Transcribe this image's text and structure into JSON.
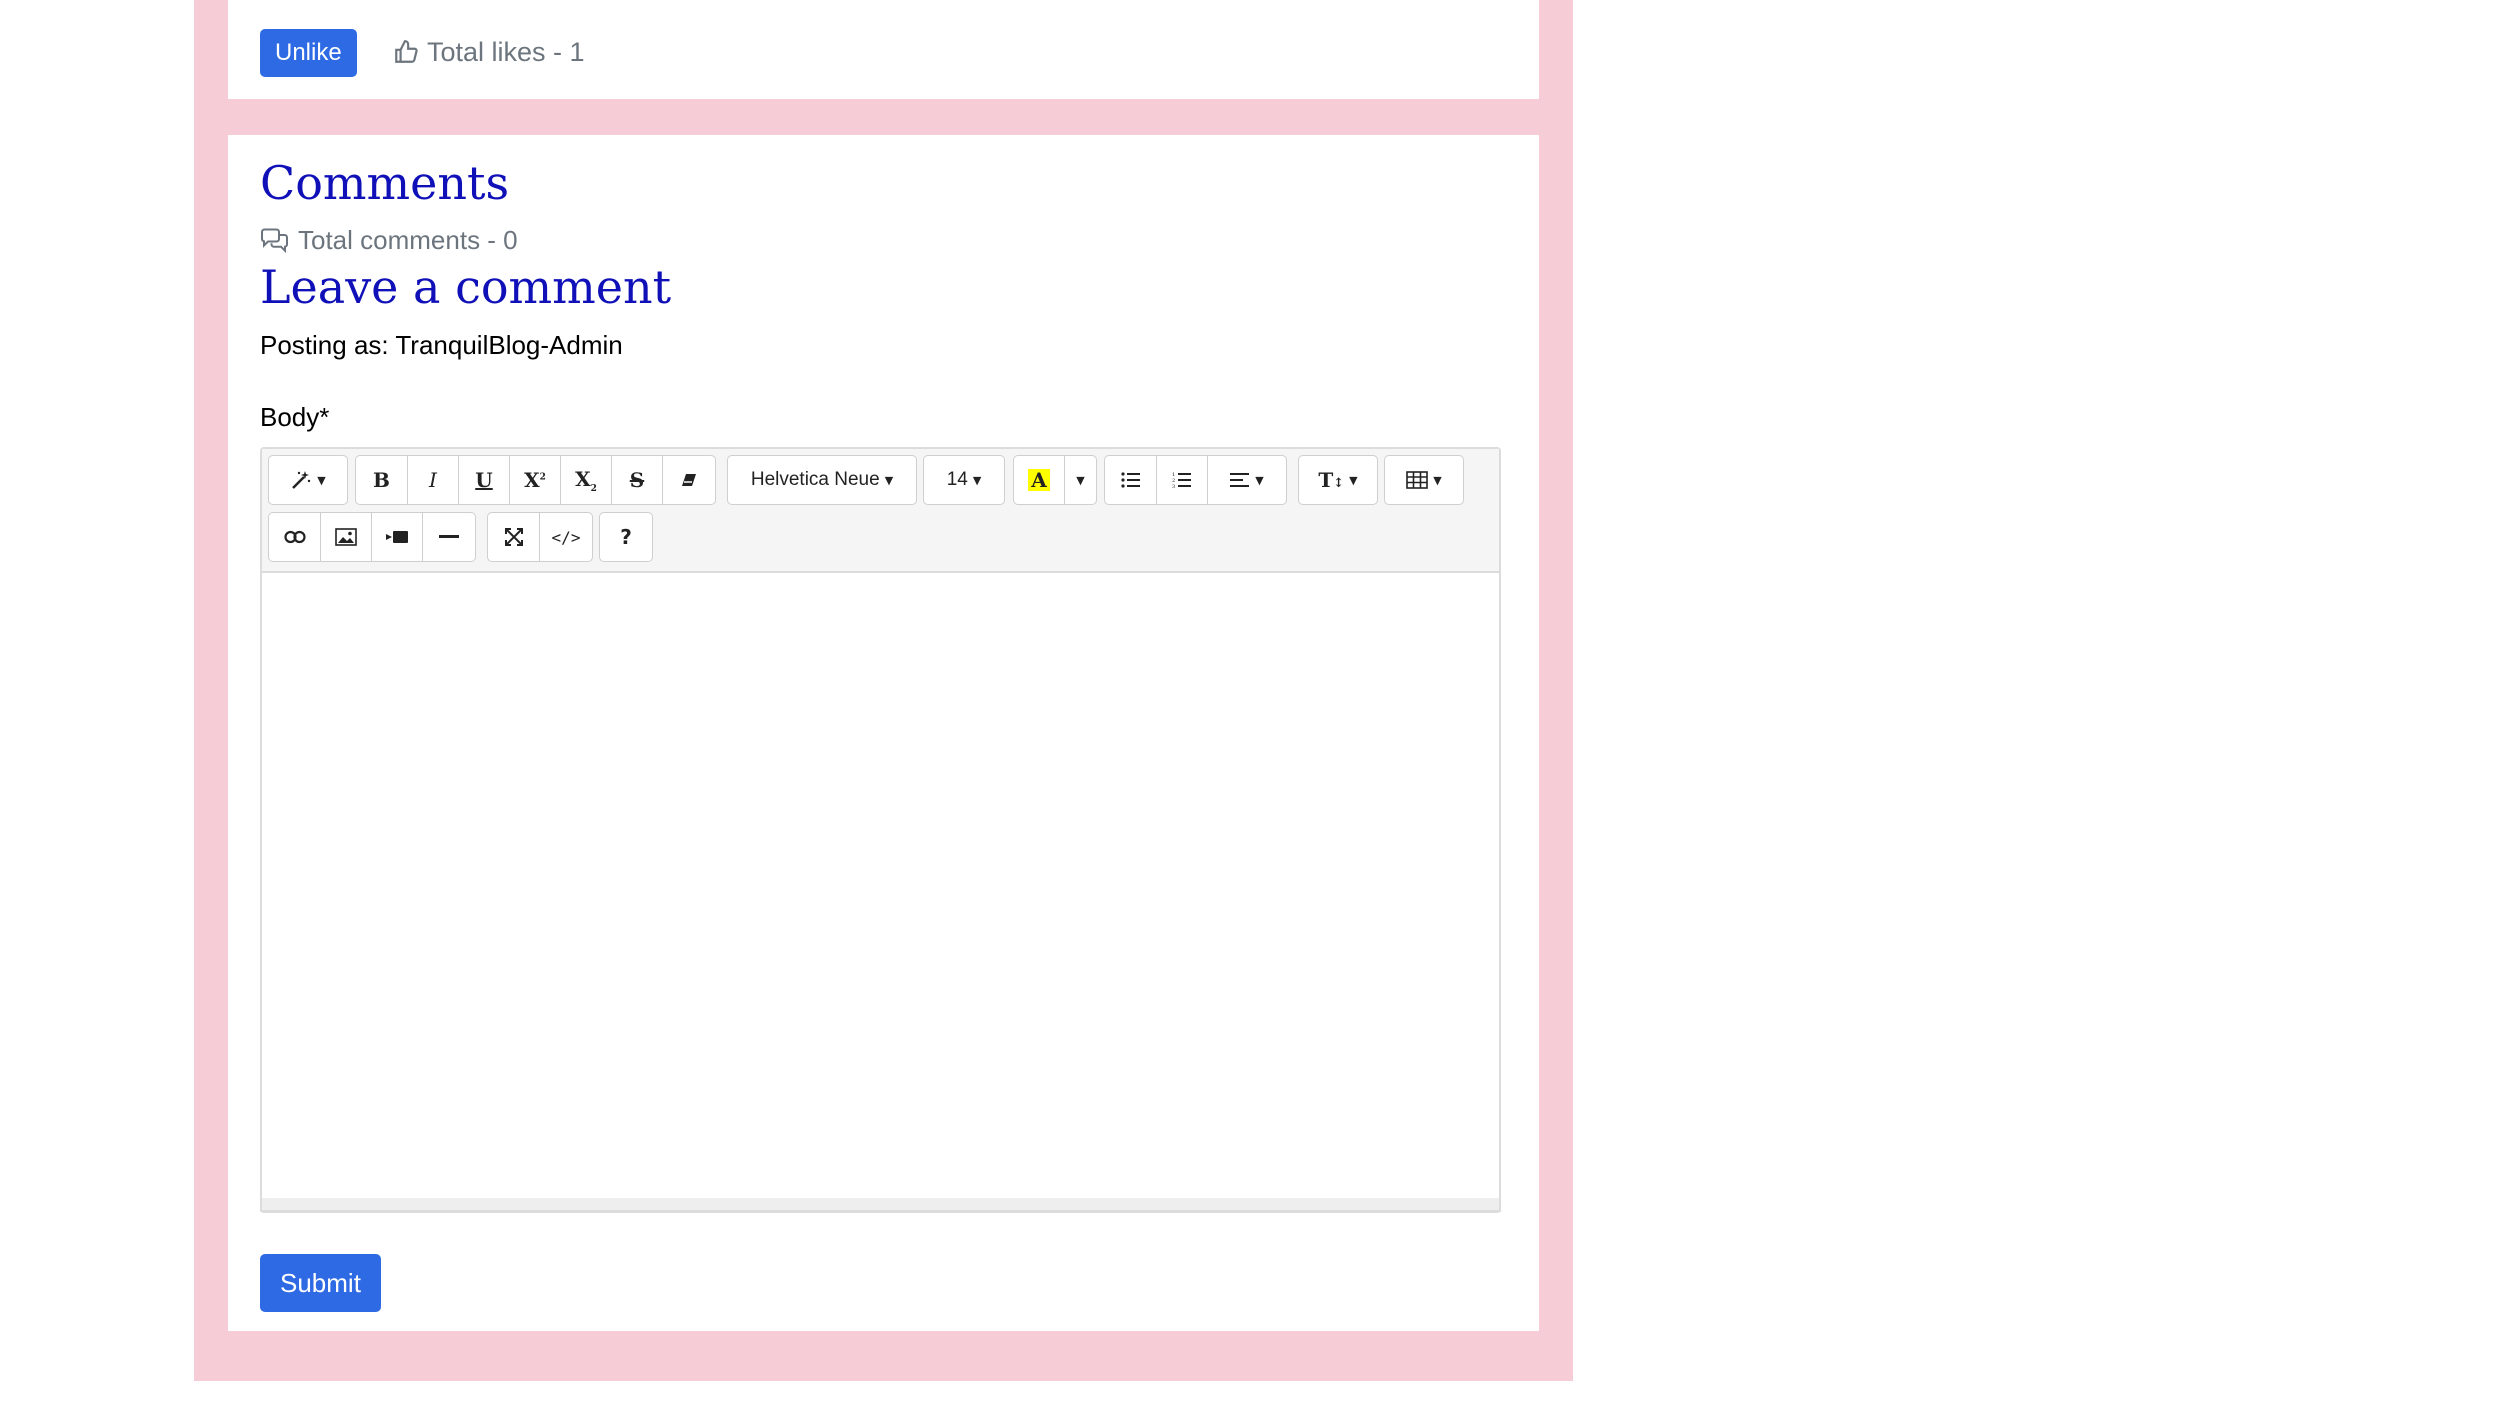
{
  "post_actions": {
    "unlike_label": "Unlike",
    "likes_text": "Total likes - 1"
  },
  "comments": {
    "heading": "Comments",
    "total_text": "Total comments - 0",
    "leave_heading": "Leave a comment",
    "posting_as": "Posting as: TranquilBlog-Admin",
    "body_label": "Body*",
    "submit_label": "Submit"
  },
  "editor": {
    "font_family_value": "Helvetica Neue",
    "font_size_value": "14",
    "icons": [
      "magic-wand-icon",
      "bold-icon",
      "italic-icon",
      "underline-icon",
      "superscript-icon",
      "subscript-icon",
      "strikethrough-icon",
      "eraser-icon",
      "highlight-icon",
      "unordered-list-icon",
      "ordered-list-icon",
      "align-icon",
      "line-height-icon",
      "table-icon",
      "link-icon",
      "image-icon",
      "video-icon",
      "horizontal-rule-icon",
      "fullscreen-icon",
      "code-view-icon",
      "help-icon"
    ]
  },
  "colors": {
    "page_border": "#f6cdd7",
    "primary_button": "#2d6ae3",
    "heading": "#1010b8",
    "muted_text": "#6c757d",
    "highlight_yellow": "#ffff00"
  }
}
